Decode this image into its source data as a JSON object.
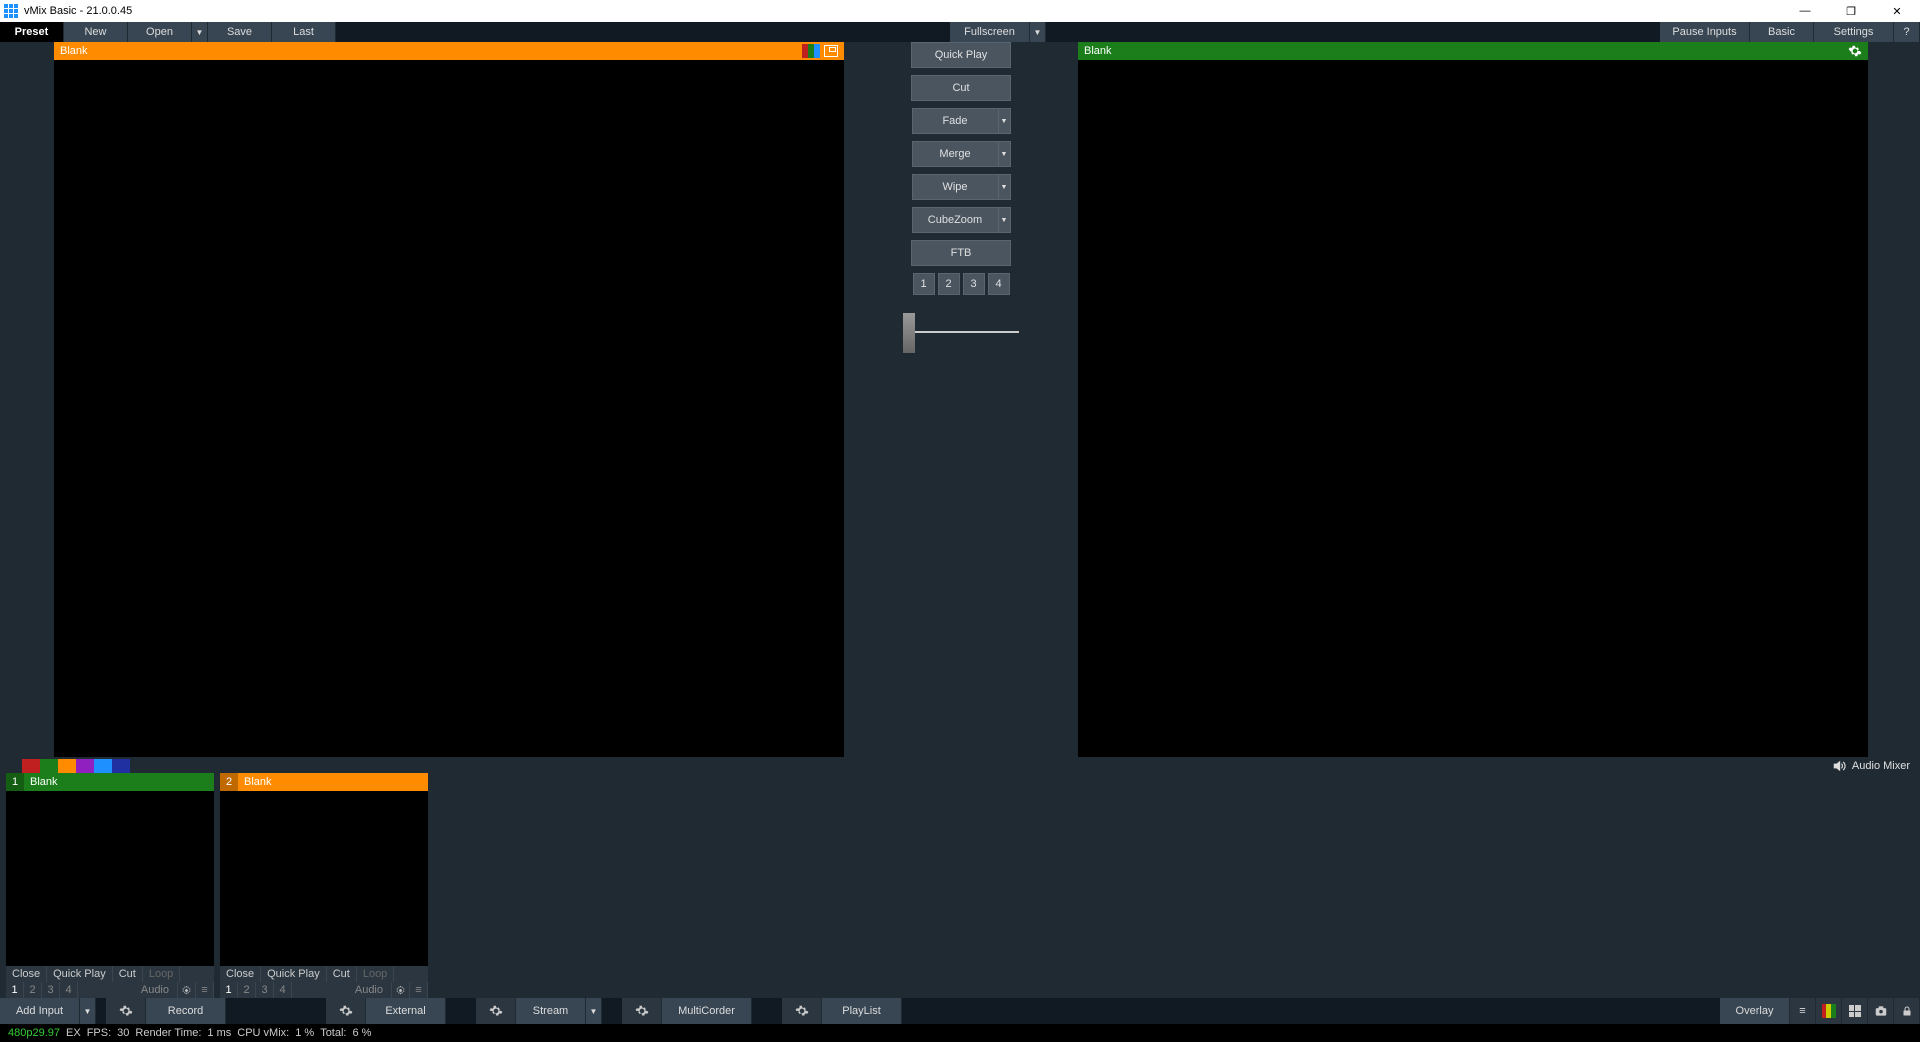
{
  "title": "vMix Basic - 21.0.0.45",
  "window_controls": {
    "min": "—",
    "max": "❐",
    "close": "✕"
  },
  "menubar": {
    "left": [
      "Preset",
      "New",
      "Open",
      "Save",
      "Last"
    ],
    "open_dd": "▼",
    "fullscreen": "Fullscreen",
    "fullscreen_dd": "▼",
    "right": [
      "Pause Inputs",
      "Basic",
      "Settings",
      "?"
    ]
  },
  "preview": {
    "title": "Blank"
  },
  "program": {
    "title": "Blank"
  },
  "transitions": {
    "quickplay": "Quick Play",
    "cut": "Cut",
    "fade": "Fade",
    "merge": "Merge",
    "wipe": "Wipe",
    "cubezoom": "CubeZoom",
    "ftb": "FTB",
    "dd": "▼",
    "numbers": [
      "1",
      "2",
      "3",
      "4"
    ]
  },
  "categories": [
    "#c02020",
    "#1b7e1b",
    "#ff8c00",
    "#9020c0",
    "#1e90ff",
    "#2030a0"
  ],
  "audio_mixer_label": "Audio Mixer",
  "inputs": [
    {
      "num": "1",
      "title": "Blank",
      "color": "green",
      "r1": [
        "Close",
        "Quick Play",
        "Cut",
        "Loop"
      ],
      "r2": [
        "1",
        "2",
        "3",
        "4"
      ],
      "audio": "Audio"
    },
    {
      "num": "2",
      "title": "Blank",
      "color": "orange",
      "r1": [
        "Close",
        "Quick Play",
        "Cut",
        "Loop"
      ],
      "r2": [
        "1",
        "2",
        "3",
        "4"
      ],
      "audio": "Audio"
    }
  ],
  "footer": {
    "add_input": "Add Input",
    "add_dd": "▼",
    "record": "Record",
    "external": "External",
    "stream": "Stream",
    "stream_dd": "▼",
    "multicorder": "MultiCorder",
    "playlist": "PlayList",
    "overlay": "Overlay"
  },
  "status": {
    "res": "480p29.97",
    "ex": "EX",
    "fps_l": "FPS:",
    "fps": "30",
    "rt_l": "Render Time:",
    "rt": "1 ms",
    "cpu_l": "CPU vMix:",
    "cpu": "1 %",
    "tot_l": "Total:",
    "tot": "6 %"
  }
}
